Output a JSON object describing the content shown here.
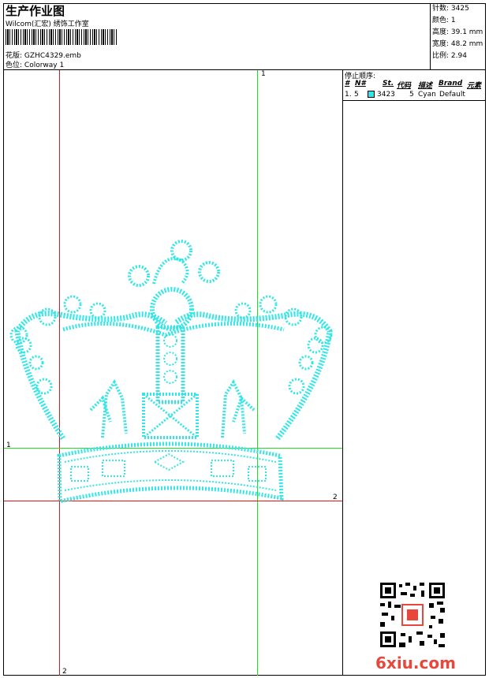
{
  "header": {
    "title": "生产作业图",
    "subtitle": "Wilcom(汇宏) 绣饰工作室",
    "design_label": "花版:",
    "design_value": "GZHC4329.emb",
    "colorway_label": "色位:",
    "colorway_value": "Colorway 1"
  },
  "stats": {
    "stitches": "针数: 3425",
    "colors": "颜色: 1",
    "height": "高度: 39.1 mm",
    "width": "宽度: 48.2 mm",
    "scale": "比例: 2.94"
  },
  "stop_sequence": {
    "title": "停止顺序:",
    "headers": [
      "#",
      "N#",
      "St.",
      "代码",
      "描述",
      "Brand",
      "元素"
    ],
    "rows": [
      {
        "num": "1.",
        "needle": "5",
        "stitches": "3423",
        "code": "5",
        "description": "Cyan",
        "brand": "Default"
      }
    ],
    "colors": {
      "cyan": "#33e6e6"
    }
  },
  "guides": {
    "top_label": "1",
    "left_label": "1",
    "right_label": "2",
    "bottom_label": "2",
    "colors": {
      "green": "#22dd22",
      "red": "#ee1111"
    }
  },
  "design": {
    "stitch_color": "#33e6e6",
    "motif": "crown-embroidery"
  },
  "watermark": {
    "text": "6xiu.com",
    "color": "#e8483c"
  }
}
